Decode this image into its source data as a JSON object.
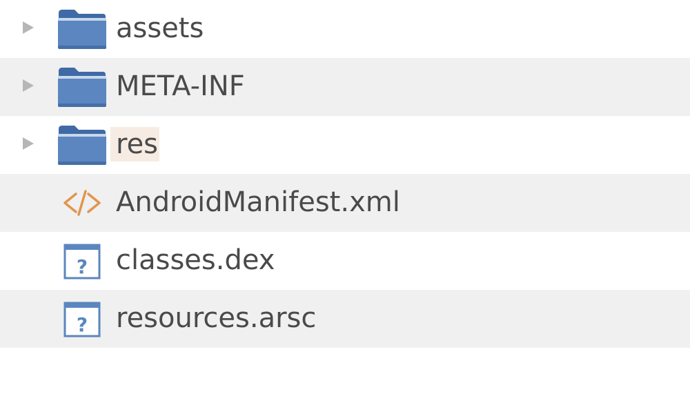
{
  "colors": {
    "folder": "#5b86bf",
    "folder_dark": "#3f6aa5",
    "xml_icon": "#e1954d",
    "file_icon": "#5b86bf",
    "row_alt": "#f0f0f0",
    "text": "#4a4a4a",
    "expander": "#b6b6b6",
    "rename_highlight": "#f6ece4"
  },
  "items": [
    {
      "name": "assets",
      "type": "folder",
      "icon": "folder-icon",
      "expandable": true
    },
    {
      "name": "META-INF",
      "type": "folder",
      "icon": "folder-icon",
      "expandable": true
    },
    {
      "name": "res",
      "type": "folder",
      "icon": "folder-icon",
      "expandable": true
    },
    {
      "name": "AndroidManifest.xml",
      "type": "file",
      "icon": "xml-code-icon",
      "expandable": false
    },
    {
      "name": "classes.dex",
      "type": "file",
      "icon": "unknown-file-icon",
      "expandable": false
    },
    {
      "name": "resources.arsc",
      "type": "file",
      "icon": "unknown-file-icon",
      "expandable": false
    }
  ]
}
